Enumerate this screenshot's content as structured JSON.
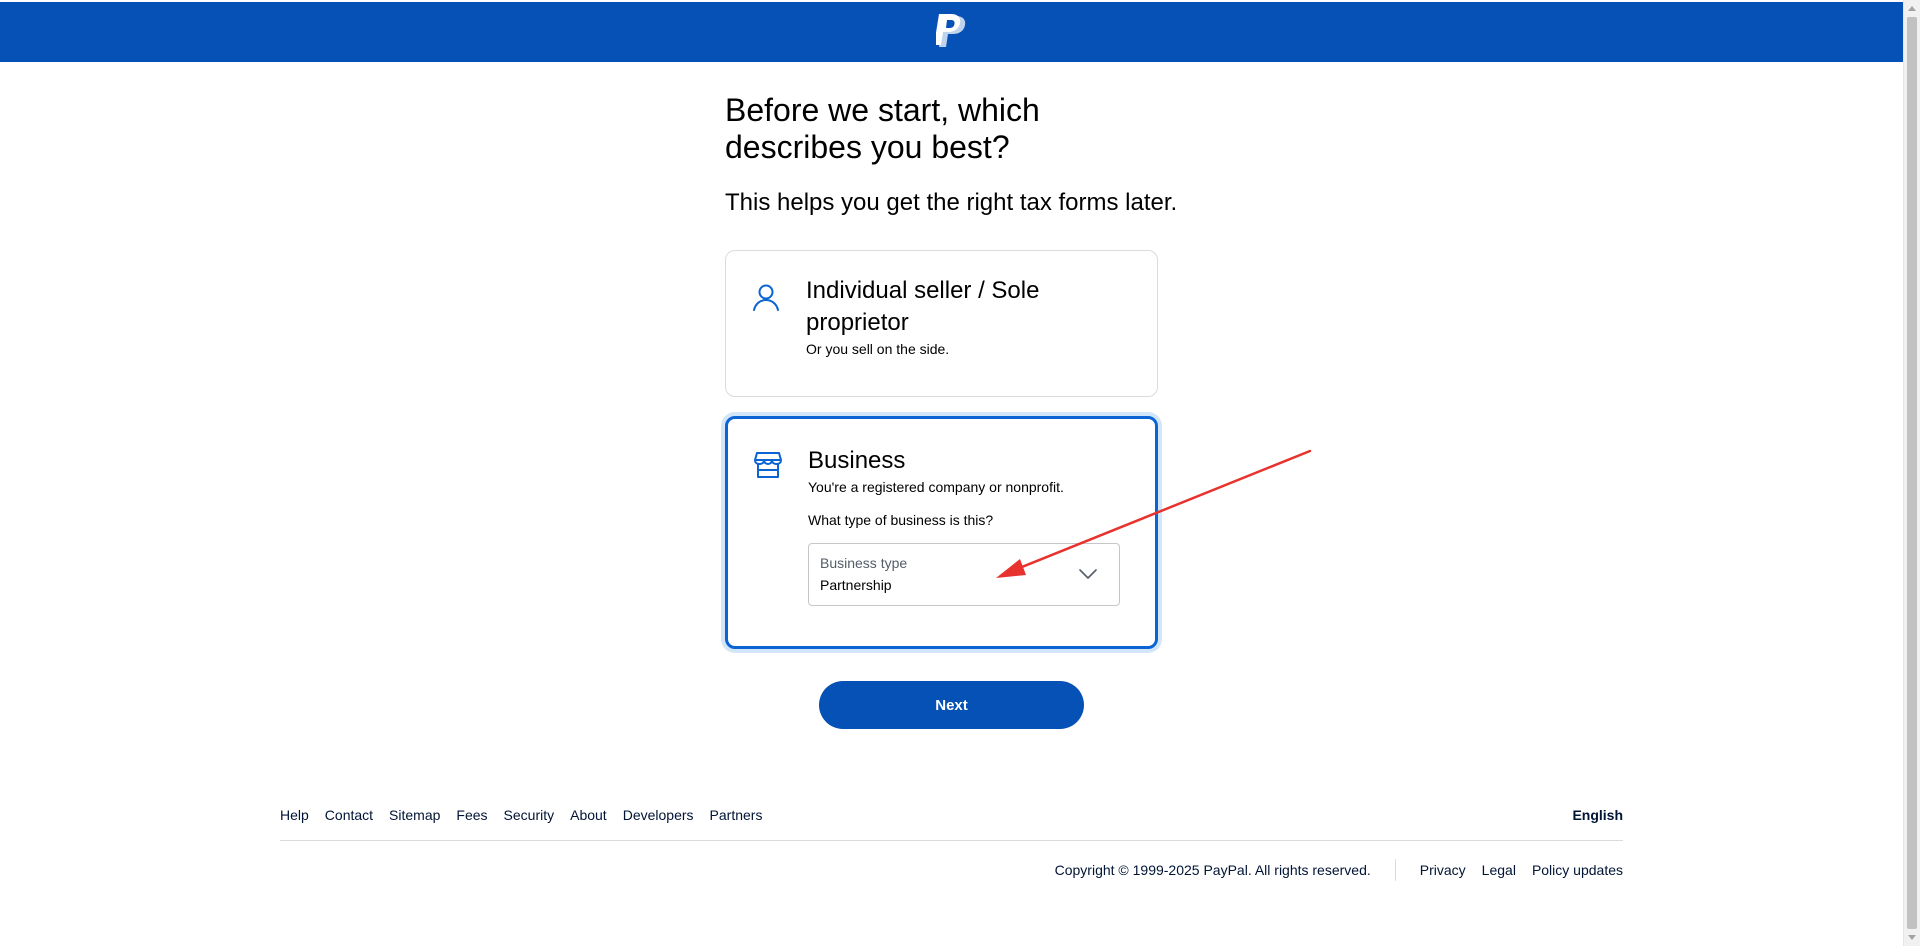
{
  "brand": {
    "logo_icon": "paypal-logo-icon",
    "header_color": "#0551b5",
    "accent_color": "#0a64d3"
  },
  "page": {
    "title": "Before we start, which describes you best?",
    "subtitle": "This helps you get the right tax forms later."
  },
  "options": {
    "individual": {
      "icon": "person-icon",
      "title": "Individual seller / Sole proprietor",
      "description": "Or you sell on the side.",
      "selected": false
    },
    "business": {
      "icon": "storefront-icon",
      "title": "Business",
      "description": "You're a registered company or nonprofit.",
      "question": "What type of business is this?",
      "selected": true,
      "business_type": {
        "label": "Business type",
        "value": "Partnership"
      }
    }
  },
  "next_button": {
    "label": "Next"
  },
  "footer": {
    "links": [
      "Help",
      "Contact",
      "Sitemap",
      "Fees",
      "Security",
      "About",
      "Developers",
      "Partners"
    ],
    "language": "English",
    "copyright": "Copyright © 1999-2025 PayPal. All rights reserved.",
    "legal_links": [
      "Privacy",
      "Legal",
      "Policy updates"
    ]
  }
}
